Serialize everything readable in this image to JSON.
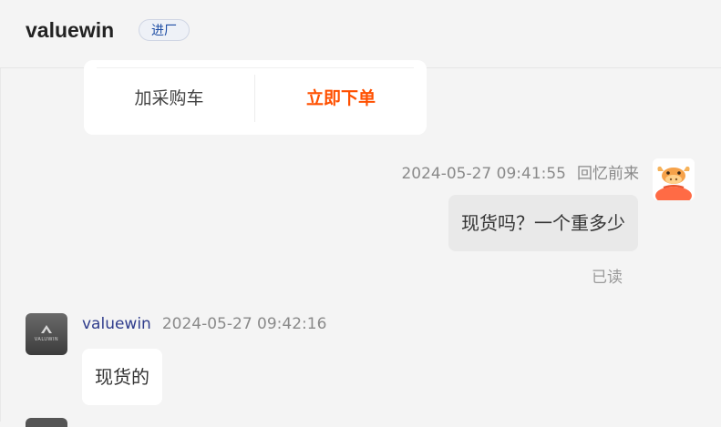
{
  "header": {
    "shop_name": "valuewin",
    "badge": "进厂"
  },
  "product_card": {
    "add_cart_label": "加采购车",
    "order_now_label": "立即下单"
  },
  "messages": [
    {
      "direction": "outgoing",
      "time": "2024-05-27 09:41:55",
      "sender": "回忆前来",
      "text": "现货吗？一个重多少",
      "status": "已读",
      "avatar_icon": "cartoon-ox-avatar-icon"
    },
    {
      "direction": "incoming",
      "sender": "valuewin",
      "time": "2024-05-27 09:42:16",
      "text": "现货的",
      "avatar_icon": "valuewin-logo-avatar-icon",
      "avatar_logo_text": "VALUWIN"
    }
  ],
  "colors": {
    "background": "#f4f4f4",
    "accent_order": "#ff5000",
    "nick": "#2f3c8c",
    "badge_text": "#1f4ea5",
    "outgoing_bubble": "#e9e9e9",
    "incoming_bubble": "#ffffff"
  }
}
